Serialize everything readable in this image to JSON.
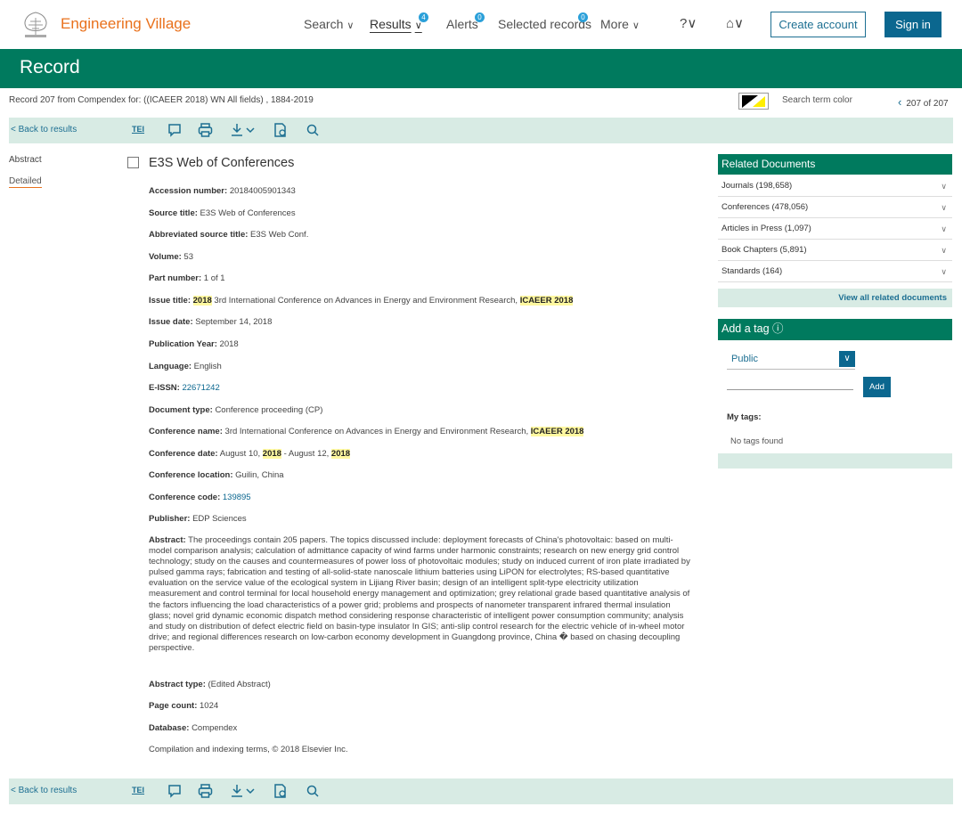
{
  "nav": {
    "brand": "Engineering Village",
    "items": [
      {
        "label": "Search",
        "chev": "∨"
      },
      {
        "label": "Results",
        "chev": "∨",
        "badge": "4"
      },
      {
        "label": "Alerts",
        "badge": "0"
      },
      {
        "label": "Selected records",
        "badge": "0"
      },
      {
        "label": "More",
        "chev": "∨"
      }
    ],
    "help_icon": "?∨",
    "institution_icon": "⌂∨",
    "create_account": "Create account",
    "sign_in": "Sign in"
  },
  "header": {
    "title": "Record"
  },
  "breadcrumb": "Record 207 from Compendex for: ((ICAEER 2018) WN All fields) , 1884-2019",
  "search_term_color_label": "Search term color",
  "pager": {
    "prev_arrow": "‹",
    "text": "207 of 207"
  },
  "toolbar": {
    "back_label": "< Back to results",
    "tei": "TEI",
    "icons": [
      "comment-icon",
      "print-icon",
      "download-icon",
      "bookmark-icon",
      "search-icon"
    ]
  },
  "leftnav": {
    "abstract": "Abstract",
    "detailed": "Detailed"
  },
  "record": {
    "title": "E3S Web of Conferences",
    "accession_label": "Accession number:",
    "accession": "20184005901343",
    "source_label": "Source title:",
    "source": "E3S Web of Conferences",
    "abbrev_label": "Abbreviated source title:",
    "abbrev": "E3S Web Conf.",
    "volume_label": "Volume:",
    "volume": "53",
    "part_label": "Part number:",
    "part": "1 of 1",
    "issue_title_label": "Issue title:",
    "issue_title_hl1": "2018",
    "issue_title_mid": "3rd International Conference on Advances in Energy and Environment Research,",
    "issue_title_hl2": "ICAEER 2018",
    "issue_date_label": "Issue date:",
    "issue_date": "September 14, 2018",
    "pub_year_label": "Publication Year:",
    "pub_year": "2018",
    "language_label": "Language:",
    "language": "English",
    "eissn_label": "E-ISSN:",
    "eissn": "22671242",
    "doctype_label": "Document type:",
    "doctype": "Conference proceeding (CP)",
    "conf_name_label": "Conference name:",
    "conf_name": "3rd International Conference on Advances in Energy and Environment Research,",
    "conf_name_hl": "ICAEER 2018",
    "conf_date_label": "Conference date:",
    "conf_date_a": "August 10,",
    "conf_date_hl1": "2018",
    "conf_date_b": "- August 12,",
    "conf_date_hl2": "2018",
    "conf_loc_label": "Conference location:",
    "conf_loc": "Guilin, China",
    "conf_code_label": "Conference code:",
    "conf_code": "139895",
    "publisher_label": "Publisher:",
    "publisher": "EDP Sciences",
    "abstract_label": "Abstract:",
    "abstract": "The proceedings contain 205 papers. The topics discussed include: deployment forecasts of China's photovoltaic: based on multi-model comparison analysis; calculation of admittance capacity of wind farms under harmonic constraints; research on new energy grid control technology; study on the causes and countermeasures of power loss of photovoltaic modules; study on induced current of iron plate irradiated by pulsed gamma rays; fabrication and testing of all-solid-state nanoscale lithium batteries using LiPON for electrolytes; RS-based quantitative evaluation on the service value of the ecological system in Lijiang River basin; design of an intelligent split-type electricity utilization measurement and control terminal for local household energy management and optimization; grey relational grade based quantitative analysis of the factors influencing the load characteristics of a power grid; problems and prospects of nanometer transparent infrared thermal insulation glass; novel grid dynamic economic dispatch method considering response characteristic of intelligent power consumption community; analysis and study on distribution of defect electric field on basin-type insulator In GIS; anti-slip control research for the electric vehicle of in-wheel motor drive; and regional differences research on low-carbon economy development in Guangdong province, China � based on chasing decoupling perspective.",
    "abstract_type_label": "Abstract type:",
    "abstract_type": "(Edited Abstract)",
    "page_count_label": "Page count:",
    "page_count": "1024",
    "database_label": "Database:",
    "database": "Compendex",
    "copyright": "Compilation and indexing terms, © 2018 Elsevier Inc."
  },
  "related": {
    "title": "Related Documents",
    "rows": [
      "Journals (198,658)",
      "Conferences (478,056)",
      "Articles in Press (1,097)",
      "Book Chapters (5,891)",
      "Standards (164)"
    ],
    "view_all": "View all related documents"
  },
  "tag": {
    "title": "Add a tag ⓘ",
    "visibility": "Public",
    "add": "Add",
    "my_tags": "My tags:",
    "none": "No tags found"
  },
  "colors": {
    "brand_green": "#007a5e",
    "link_blue": "#0b678f",
    "orange": "#e9711c",
    "highlight": "#fff8a0"
  }
}
